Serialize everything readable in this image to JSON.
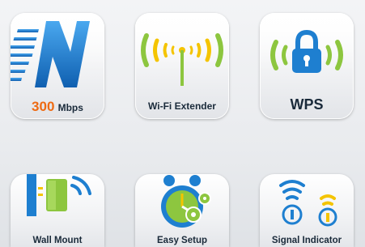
{
  "features": [
    {
      "id": "speed",
      "value": "300",
      "unit": "Mbps",
      "icon": "n-standard-icon"
    },
    {
      "id": "extender",
      "label": "Wi-Fi Extender",
      "icon": "wifi-antenna-icon"
    },
    {
      "id": "wps",
      "label": "WPS",
      "icon": "wps-lock-icon"
    },
    {
      "id": "wall",
      "label": "Wall Mount",
      "icon": "wall-mount-icon"
    },
    {
      "id": "setup",
      "label": "Easy Setup",
      "icon": "alarm-clock-gear-icon"
    },
    {
      "id": "signal",
      "label": "Signal Indicator",
      "icon": "signal-indicator-icon"
    }
  ],
  "colors": {
    "blue": "#1e7fd0",
    "green": "#8dc63f",
    "orange": "#ee6a12",
    "yellow": "#f4c400",
    "label": "#1a2a3a"
  }
}
